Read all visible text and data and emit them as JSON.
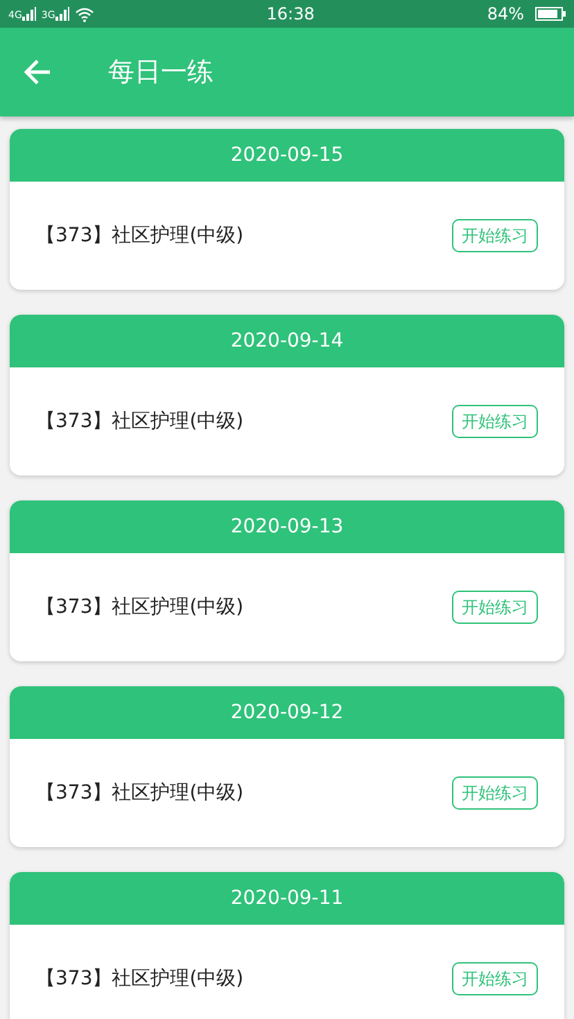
{
  "status_bar": {
    "signal_1": "4G",
    "signal_2": "3G",
    "time": "16:38",
    "battery": "84%"
  },
  "header": {
    "title": "每日一练"
  },
  "cards": [
    {
      "date": "2020-09-15",
      "subject": "【373】社区护理(中级)",
      "action": "开始练习"
    },
    {
      "date": "2020-09-14",
      "subject": "【373】社区护理(中级)",
      "action": "开始练习"
    },
    {
      "date": "2020-09-13",
      "subject": "【373】社区护理(中级)",
      "action": "开始练习"
    },
    {
      "date": "2020-09-12",
      "subject": "【373】社区护理(中级)",
      "action": "开始练习"
    },
    {
      "date": "2020-09-11",
      "subject": "【373】社区护理(中级)",
      "action": "开始练习"
    }
  ]
}
